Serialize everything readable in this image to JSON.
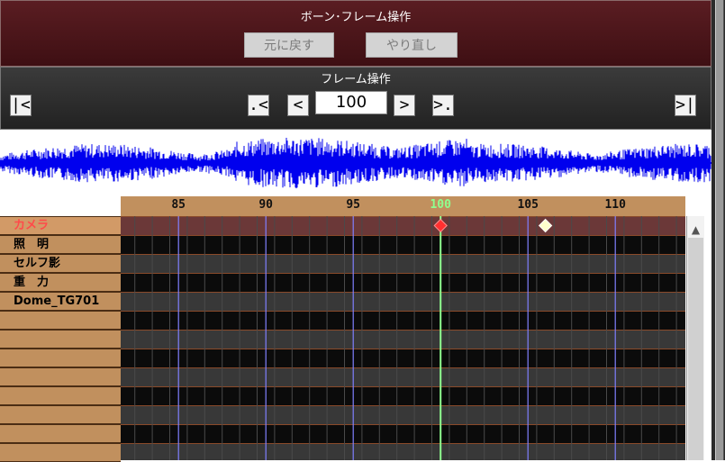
{
  "bone_frame_panel": {
    "title": "ボーン･フレーム操作",
    "undo_label": "元に戻す",
    "redo_label": "やり直し"
  },
  "frame_panel": {
    "title": "フレーム操作",
    "first_label": "|<",
    "prev_key_label": ".<",
    "prev_label": "<",
    "current_frame": "100",
    "next_label": ">",
    "next_key_label": ">.",
    "last_label": ">|"
  },
  "timeline": {
    "tick_labels": [
      "85",
      "90",
      "95",
      "100",
      "105",
      "110"
    ],
    "current_frame": 100,
    "tracks": [
      {
        "name": "カメラ",
        "active": true
      },
      {
        "name": "照　明",
        "active": false
      },
      {
        "name": "セルフ影",
        "active": false
      },
      {
        "name": "重　力",
        "active": false
      },
      {
        "name": "Dome_TG701",
        "active": false
      },
      {
        "name": "",
        "active": false
      },
      {
        "name": "",
        "active": false
      },
      {
        "name": "",
        "active": false
      },
      {
        "name": "",
        "active": false
      },
      {
        "name": "",
        "active": false
      },
      {
        "name": "",
        "active": false
      },
      {
        "name": "",
        "active": false
      },
      {
        "name": "",
        "active": false
      }
    ],
    "keyframes": [
      {
        "track": "カメラ",
        "frame": 100,
        "selected": true
      },
      {
        "track": "カメラ",
        "frame": 106,
        "selected": false
      }
    ]
  },
  "colors": {
    "panel_dark_red": "#4e1519",
    "ruler_tan": "#c1905e",
    "active_track_text": "#ff4a4a",
    "waveform_blue": "#0000ee",
    "current_frame_line": "#8fff8f",
    "marker_line": "#8080ff",
    "selected_keyframe": "#ff3030",
    "keyframe": "#ffffcc"
  },
  "scrollbar": {
    "up_icon": "▲"
  }
}
